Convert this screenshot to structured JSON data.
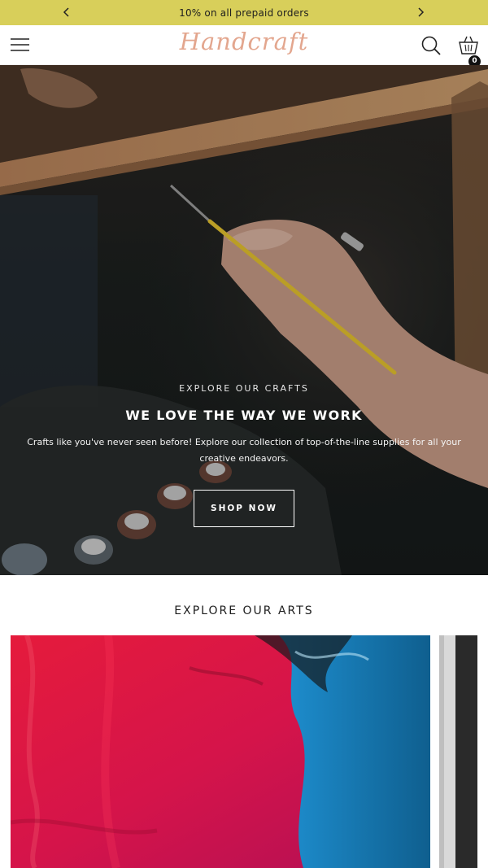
{
  "announcement": {
    "text": "10% on all prepaid orders",
    "prev_icon": "chevron-left-icon",
    "next_icon": "chevron-right-icon"
  },
  "header": {
    "logo": "Handcraft",
    "menu_icon": "hamburger-menu-icon",
    "search_icon": "search-icon",
    "cart_icon": "shopping-basket-icon",
    "cart_count": "0",
    "logo_color": "#e3a68e"
  },
  "hero": {
    "eyebrow": "EXPLORE OUR CRAFTS",
    "title": "WE LOVE THE WAY WE WORK",
    "description": "Crafts like you've never seen before! Explore our collection of top-of-the-line supplies for all your creative endeavors.",
    "button_label": "SHOP NOW"
  },
  "explore": {
    "title": "EXPLORE OUR ARTS"
  },
  "colors": {
    "announcement_bg": "#d8cf5a",
    "hero_text": "#ffffff"
  }
}
